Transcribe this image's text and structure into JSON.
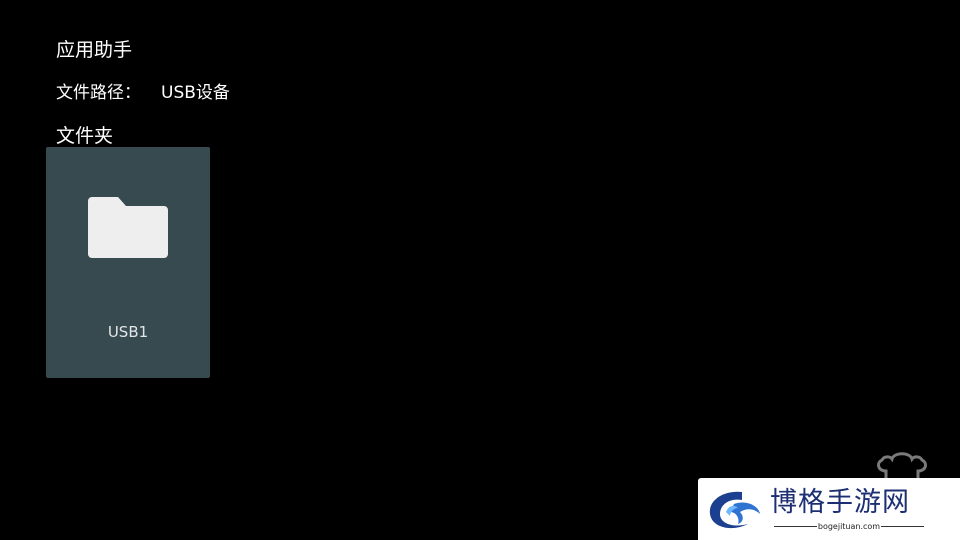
{
  "header": {
    "app_title": "应用助手"
  },
  "path": {
    "label": "文件路径：",
    "value": "USB设备"
  },
  "section": {
    "title": "文件夹"
  },
  "folders": [
    {
      "label": "USB1",
      "icon": "folder-icon"
    }
  ],
  "watermark": {
    "name": "博格手游网",
    "url": "bogejituan.com"
  },
  "colors": {
    "background": "#000000",
    "card": "#374a4f",
    "folder_icon": "#eeeeee",
    "watermark_text": "#1d2f73"
  }
}
